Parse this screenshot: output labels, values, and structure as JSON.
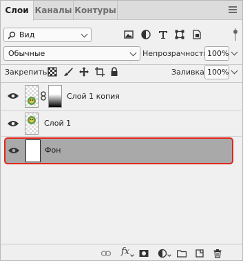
{
  "tabs": [
    {
      "label": "Слои",
      "active": true
    },
    {
      "label": "Каналы",
      "active": false
    },
    {
      "label": "Контуры",
      "active": false
    }
  ],
  "filter": {
    "selected": "Вид"
  },
  "blend": {
    "mode": "Обычные",
    "opacity_label": "Непрозрачность:",
    "opacity_value": "100%"
  },
  "lock": {
    "label": "Закрепить:",
    "fill_label": "Заливка:",
    "fill_value": "100%"
  },
  "layers": [
    {
      "name": "Слой 1 копия",
      "visible": true,
      "has_mask": true,
      "selected": false
    },
    {
      "name": "Слой 1",
      "visible": true,
      "has_mask": false,
      "selected": false
    },
    {
      "name": "Фон",
      "visible": true,
      "has_mask": false,
      "selected": true
    }
  ],
  "bottom": {
    "fx_label": "fx"
  },
  "colors": {
    "selection_border": "#e0261b",
    "selected_row": "#a9a9a9",
    "panel_bg": "#f0f0f0"
  }
}
